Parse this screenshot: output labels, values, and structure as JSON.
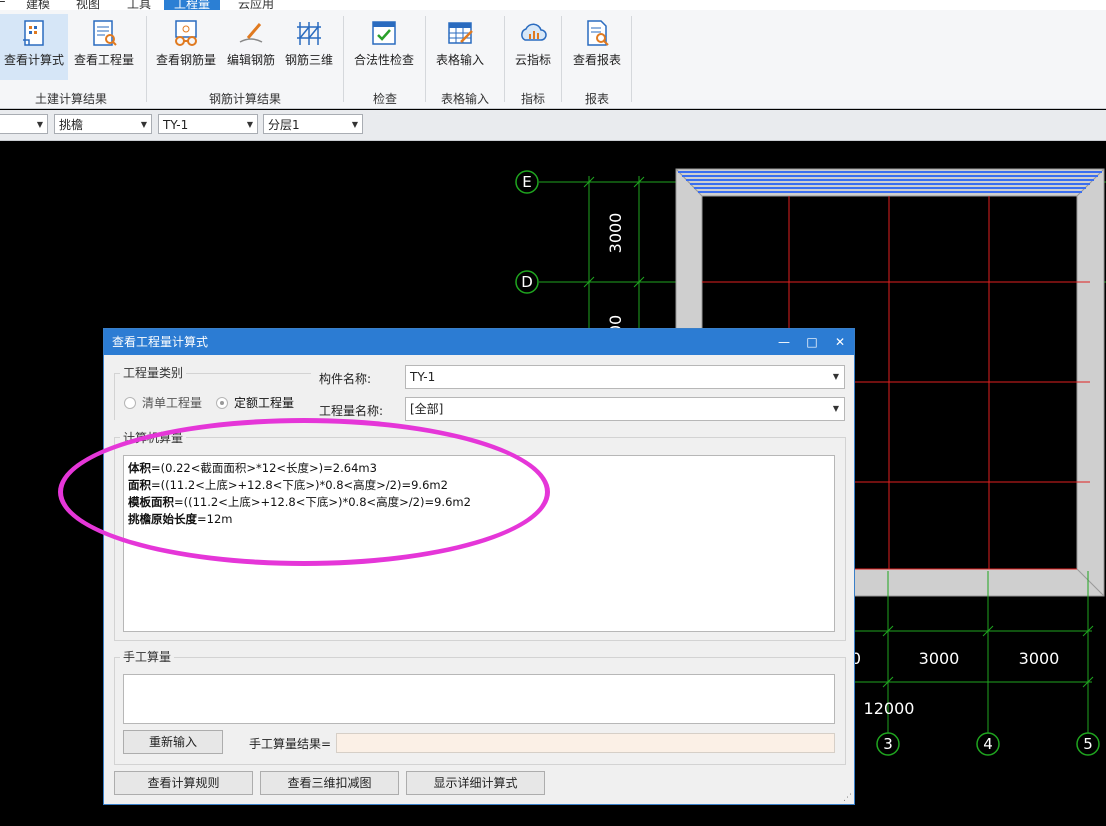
{
  "menu": {
    "items": [
      "建模",
      "视图",
      "工具",
      "工程量",
      "云应用"
    ],
    "active_index": 3
  },
  "ribbon": {
    "buttons": [
      {
        "label": "查看计算式",
        "icon": "view-formula-icon"
      },
      {
        "label": "查看工程量",
        "icon": "view-quantity-icon"
      },
      {
        "label": "查看钢筋量",
        "icon": "view-rebar-icon"
      },
      {
        "label": "编辑钢筋",
        "icon": "edit-rebar-icon"
      },
      {
        "label": "钢筋三维",
        "icon": "rebar-3d-icon"
      },
      {
        "label": "合法性检查",
        "icon": "validity-check-icon"
      },
      {
        "label": "表格输入",
        "icon": "table-input-icon"
      },
      {
        "label": "云指标",
        "icon": "cloud-index-icon"
      },
      {
        "label": "查看报表",
        "icon": "view-report-icon"
      }
    ],
    "groups": [
      "土建计算结果",
      "钢筋计算结果",
      "检查",
      "表格输入",
      "指标",
      "报表"
    ]
  },
  "toolbar": {
    "selects": [
      "",
      "挑檐",
      "TY-1",
      "分层1"
    ]
  },
  "canvas": {
    "axis_labels_row": [
      "E",
      "D"
    ],
    "axis_labels_col": [
      "3",
      "4",
      "5"
    ],
    "dims_vertical": [
      "3000",
      "00"
    ],
    "dims_horizontal": [
      "0",
      "3000",
      "3000"
    ],
    "dim_total": "12000",
    "colors": {
      "grid_green": "#1fa51f",
      "wall_gray": "#c8c8c8",
      "red_line": "#e02020",
      "blue": "#3a6ef0"
    }
  },
  "dialog": {
    "title": "查看工程量计算式",
    "category_label": "工程量类别",
    "radio_list": "清单工程量",
    "radio_quota": "定额工程量",
    "component_name_label": "构件名称:",
    "component_name_value": "TY-1",
    "quantity_name_label": "工程量名称:",
    "quantity_name_value": "[全部]",
    "calc_section_label": "计算机算量",
    "formulas": [
      {
        "name": "体积",
        "expr": "=(0.22<截面面积>*12<长度>)=2.64m3"
      },
      {
        "name": "面积",
        "expr": "=((11.2<上底>+12.8<下底>)*0.8<高度>/2)=9.6m2"
      },
      {
        "name": "模板面积",
        "expr": "=((11.2<上底>+12.8<下底>)*0.8<高度>/2)=9.6m2"
      },
      {
        "name": "挑檐原始长度",
        "expr": "=12m"
      }
    ],
    "manual_section_label": "手工算量",
    "reinput_button": "重新输入",
    "manual_result_label": "手工算量结果=",
    "btn_rules": "查看计算规则",
    "btn_3d": "查看三维扣减图",
    "btn_detail": "显示详细计算式"
  }
}
